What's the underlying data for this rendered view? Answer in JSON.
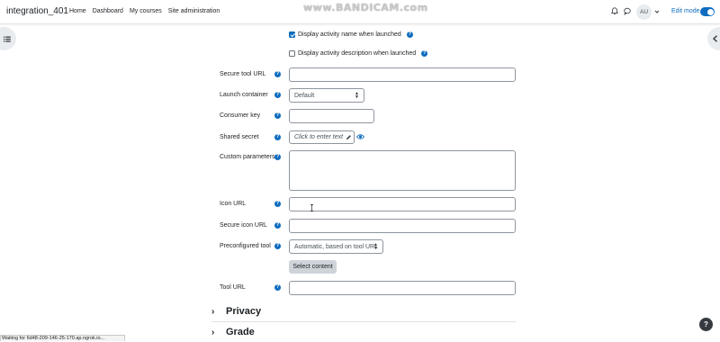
{
  "navbar": {
    "brand": "integration_401",
    "links": [
      "Home",
      "Dashboard",
      "My courses",
      "Site administration"
    ],
    "watermark": "www.BANDICAM.com",
    "avatar_initials": "AU",
    "edit_mode_label": "Edit mode",
    "edit_mode_on": true
  },
  "form": {
    "display_name_label": "Display activity name when launched",
    "display_name_checked": true,
    "display_desc_label": "Display activity description when launched",
    "display_desc_checked": false,
    "secure_tool_url_label": "Secure tool URL",
    "secure_tool_url_value": "",
    "launch_container_label": "Launch container",
    "launch_container_value": "Default",
    "consumer_key_label": "Consumer key",
    "consumer_key_value": "",
    "shared_secret_label": "Shared secret",
    "shared_secret_placeholder": "Click to enter text",
    "custom_parameters_label": "Custom parameters",
    "custom_parameters_value": "",
    "icon_url_label": "Icon URL",
    "icon_url_value": "",
    "secure_icon_url_label": "Secure icon URL",
    "secure_icon_url_value": "",
    "preconfigured_tool_label": "Preconfigured tool",
    "preconfigured_tool_value": "Automatic, based on tool URL",
    "select_content_label": "Select content",
    "tool_url_label": "Tool URL",
    "tool_url_value": "",
    "help_glyph": "?"
  },
  "sections": [
    "Privacy",
    "Grade"
  ],
  "status_bar": "Waiting for 6d48-209-146-25-170.ap.ngrok.io...",
  "help_fab": "?",
  "colors": {
    "accent": "#0f6cbf",
    "button_gray": "#ced4da",
    "text": "#1d2125"
  }
}
